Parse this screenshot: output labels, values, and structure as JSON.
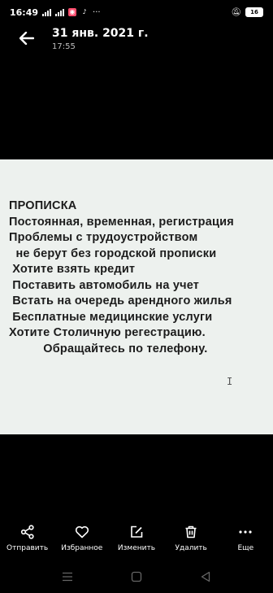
{
  "status_bar": {
    "time": "16:49",
    "battery": "16"
  },
  "header": {
    "title": "31 янв. 2021 г.",
    "subtitle": "17:55"
  },
  "image": {
    "lines": [
      "ПРОПИСКА",
      "Постоянная, временная, регистрация",
      "Проблемы с трудоустройством",
      "  не берут без городской прописки",
      " Хотите взять кредит",
      " Поставить автомобиль на учет",
      " Встать на очередь арендного жилья",
      " Бесплатные медицинские услуги",
      "Хотите Столичную регестрацию.",
      "          Обращайтесь по телефону."
    ]
  },
  "actions": {
    "share": "Отправить",
    "favorite": "Избранное",
    "edit": "Изменить",
    "delete": "Удалить",
    "more": "Еще"
  }
}
